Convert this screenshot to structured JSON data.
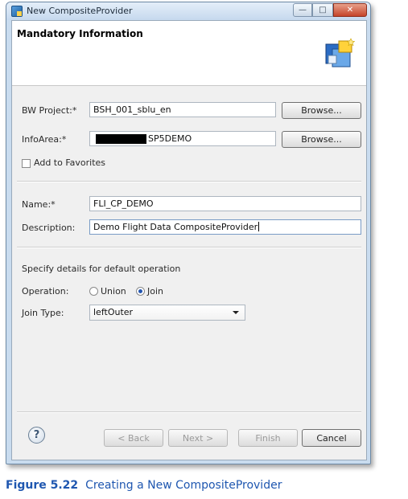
{
  "window": {
    "title": "New CompositeProvider"
  },
  "banner": {
    "title": "Mandatory Information"
  },
  "form": {
    "bw_project_label": "BW Project:*",
    "bw_project_value": "BSH_001_sblu_en",
    "infoarea_label": "InfoArea:*",
    "infoarea_value": "SP5DEMO",
    "browse_label": "Browse...",
    "add_favorites_label": "Add to Favorites",
    "name_label": "Name:*",
    "name_value": "FLI_CP_DEMO",
    "description_label": "Description:",
    "description_value": "Demo Flight Data CompositeProvider",
    "details_heading": "Specify details for default operation",
    "operation_label": "Operation:",
    "union_label": "Union",
    "join_label": "Join",
    "join_type_label": "Join Type:",
    "join_type_value": "leftOuter"
  },
  "footer": {
    "help": "?",
    "back_label": "< Back",
    "next_label": "Next >",
    "finish_label": "Finish",
    "cancel_label": "Cancel"
  },
  "caption": {
    "number": "Figure 5.22",
    "text": "Creating a New CompositeProvider"
  },
  "colors": {
    "caption": "#1f57b0",
    "radio_selected": "#2456b0"
  }
}
